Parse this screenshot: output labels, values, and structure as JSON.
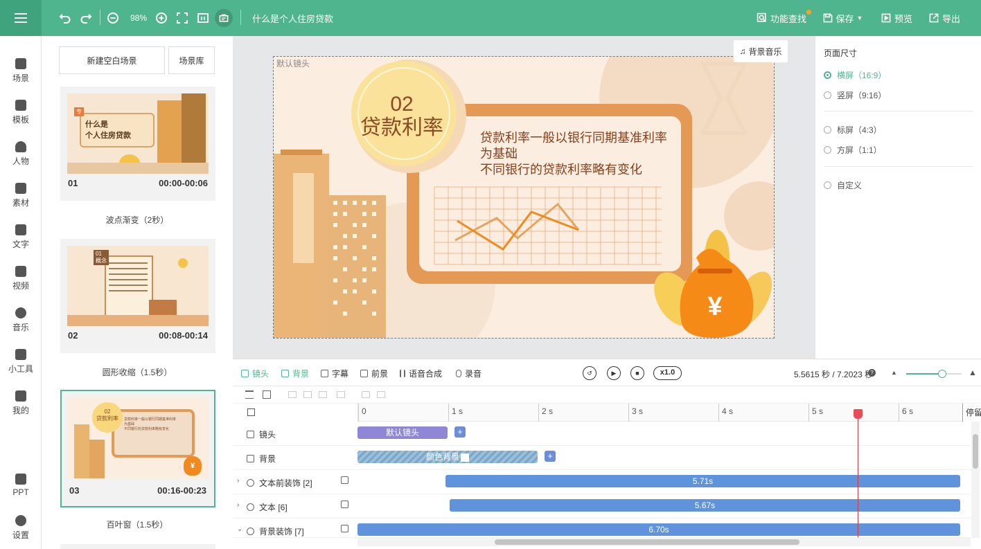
{
  "header": {
    "title": "什么是个人住房贷款",
    "zoom": "98%",
    "find": "功能查找",
    "save": "保存",
    "preview": "预览",
    "export": "导出"
  },
  "leftnav": [
    "场景",
    "模板",
    "人物",
    "素材",
    "文字",
    "视频",
    "音乐",
    "小工具",
    "我的",
    "PPT",
    "设置"
  ],
  "scenes": {
    "new_blank": "新建空白场景",
    "library": "场景库",
    "items": [
      {
        "num": "01",
        "time": "00:00-00:06",
        "transition": "波点渐变（2秒）",
        "thumb_title1": "什么是",
        "thumb_title2": "个人住房贷款",
        "thumb_badge": "专"
      },
      {
        "num": "02",
        "time": "00:08-00:14",
        "transition": "圆形收缩（1.5秒）",
        "thumb_badge1": "01",
        "thumb_badge2": "概念"
      },
      {
        "num": "03",
        "time": "00:16-00:23",
        "transition": "百叶窗（1.5秒）",
        "thumb_coin_num": "02",
        "thumb_coin_text": "贷款利率"
      }
    ]
  },
  "canvas": {
    "bg_music": "背景音乐",
    "lens_label": "默认镜头",
    "coin_num": "02",
    "coin_text": "贷款利率",
    "line1": "贷款利率一般以银行同期基准利率",
    "line2": "为基础",
    "line3": "不同银行的贷款利率略有变化",
    "bag_symbol": "¥",
    "thumb_line1": "贷款利率一般以银行同期基准利率",
    "thumb_line2": "为基础",
    "thumb_line3": "不同银行的贷款利率略有变化"
  },
  "rightpanel": {
    "title": "页面尺寸",
    "options": [
      "横屏（16:9）",
      "竖屏（9:16）",
      "标屏（4:3）",
      "方屏（1:1）",
      "自定义"
    ]
  },
  "toolbar": {
    "items": [
      "镜头",
      "背景",
      "字幕",
      "前景",
      "语音合成",
      "录音"
    ],
    "speed": "x1.0",
    "time": "5.5615 秒 / 7.2023 秒"
  },
  "timeline": {
    "ticks": [
      "0",
      "1 s",
      "2 s",
      "3 s",
      "4 s",
      "5 s",
      "6 s"
    ],
    "stop": "停留",
    "rows": [
      {
        "label": "镜头",
        "clip": "默认镜头"
      },
      {
        "label": "背景",
        "clip": "颜色背景"
      },
      {
        "label": "文本前装饰 [2]",
        "clip": "5.71s"
      },
      {
        "label": "文本 [6]",
        "clip": "5.67s"
      },
      {
        "label": "背景装饰 [7]",
        "clip": "6.70s"
      }
    ]
  },
  "colors": {
    "brand": "#4fb58e",
    "clip_lens": "#8f87d6",
    "clip_bar": "#5f94dc",
    "playhead": "#d9363e"
  }
}
